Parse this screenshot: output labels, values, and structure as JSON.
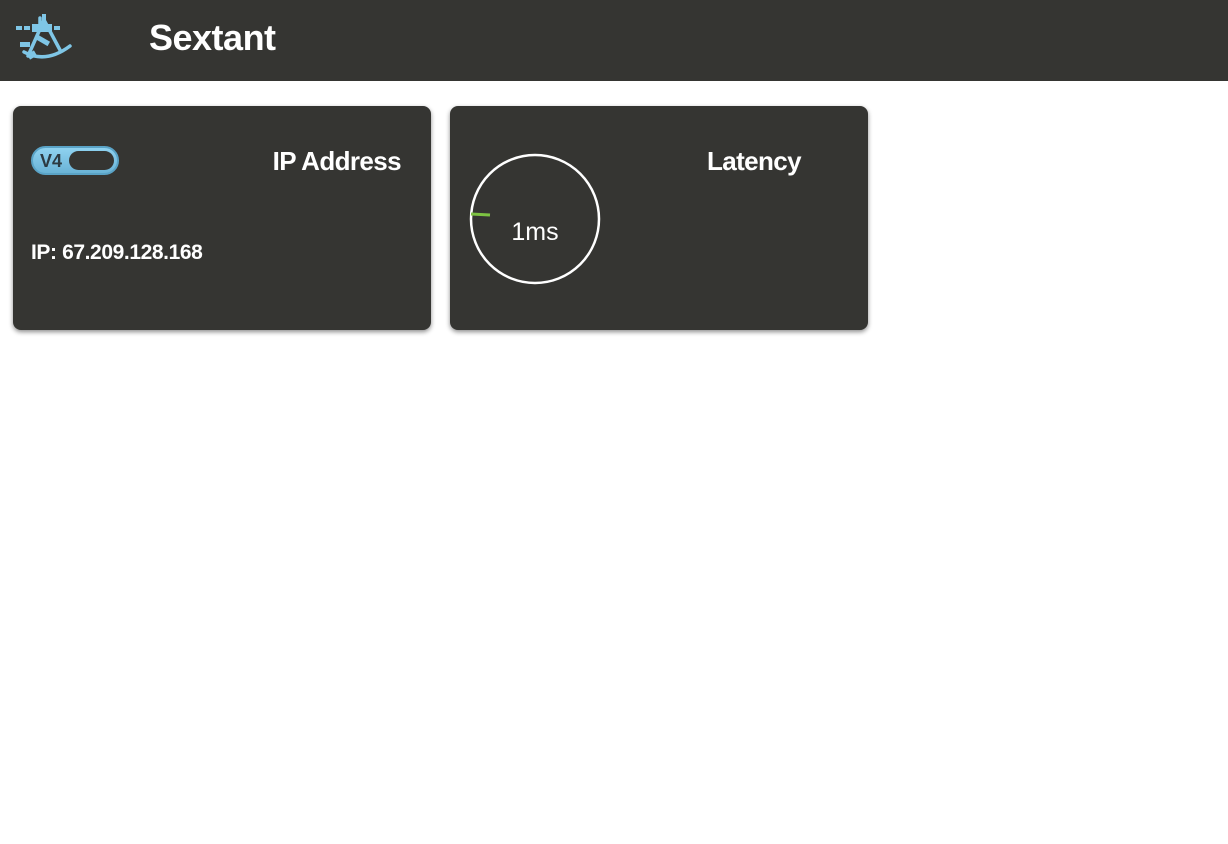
{
  "app": {
    "title": "Sextant",
    "logo_icon": "sextant-icon",
    "logo_color": "#7fc6e6"
  },
  "ip_card": {
    "title": "IP Address",
    "toggle_label": "V4",
    "ip_text": "IP: 67.209.128.168"
  },
  "latency_card": {
    "title": "Latency",
    "value_text": "1ms",
    "value_ms": 1,
    "gauge_color": "#7dc242"
  },
  "colors": {
    "bar_bg": "#353532",
    "card_bg": "#353532",
    "toggle_bg": "#7fc6e6"
  }
}
